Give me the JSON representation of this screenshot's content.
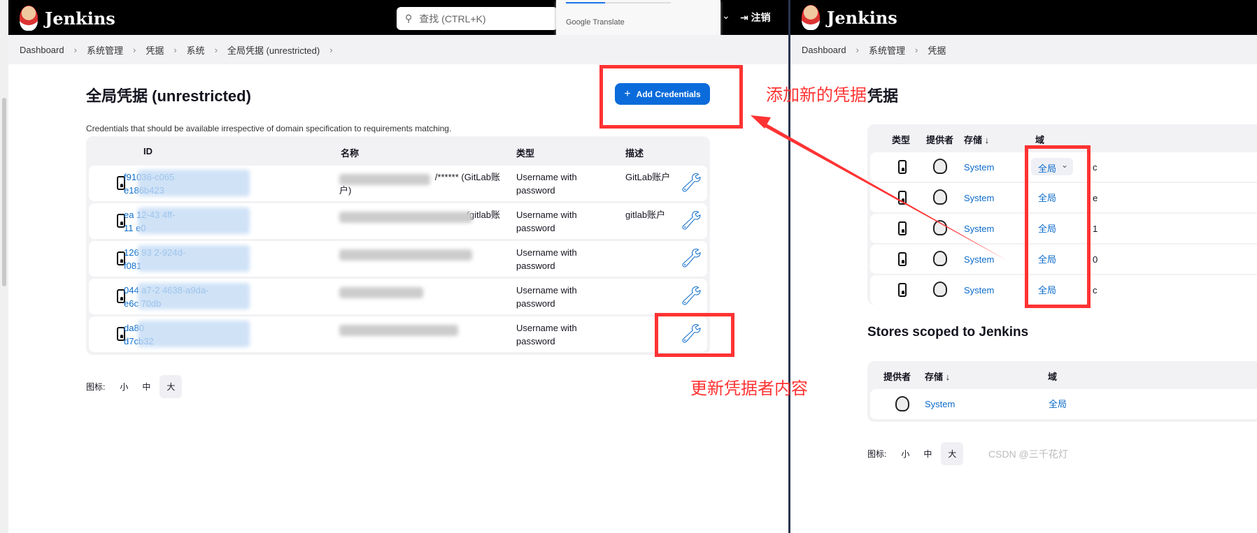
{
  "left": {
    "brand": "Jenkins",
    "search": {
      "placeholder": "查找 (CTRL+K)"
    },
    "translate_popup": "Google Translate",
    "logout": "注销",
    "breadcrumb": [
      "Dashboard",
      "系统管理",
      "凭据",
      "系统",
      "全局凭据 (unrestricted)"
    ],
    "title": "全局凭据 (unrestricted)",
    "add_button": "Add Credentials",
    "description": "Credentials that should be available irrespective of domain specification to requirements matching.",
    "columns": [
      "ID",
      "名称",
      "类型",
      "描述"
    ],
    "rows": [
      {
        "id1": "f91036-c065",
        "id2": "e186b423",
        "name1": "/****** (GitLab账",
        "name2": "户)",
        "type": "Username with password",
        "desc": "GitLab账户"
      },
      {
        "id1": "ea    12-43    4ff-",
        "id2": "11     e0",
        "name1": "(gitlab账",
        "name2": "",
        "type": "Username with password",
        "desc": "gitlab账户"
      },
      {
        "id1": "126    93   2-924d-",
        "id2": "f081",
        "name1": "",
        "name2": "",
        "type": "Username with password",
        "desc": ""
      },
      {
        "id1": "044   a7-2   4638-a9da-",
        "id2": "e6c    70db",
        "name1": "",
        "name2": "",
        "type": "Username with password",
        "desc": ""
      },
      {
        "id1": "da80",
        "id2": "d7cb32",
        "name1": "",
        "name2": "",
        "type": "Username with password",
        "desc": ""
      }
    ],
    "icon_size": {
      "label": "图标:",
      "options": [
        "小",
        "中",
        "大"
      ],
      "selected": "大"
    }
  },
  "right": {
    "brand": "Jenkins",
    "breadcrumb": [
      "Dashboard",
      "系统管理",
      "凭据"
    ],
    "title": "凭据",
    "columns": [
      "类型",
      "提供者",
      "存储 ↓",
      "域"
    ],
    "rows": [
      {
        "store": "System",
        "domain": "全局",
        "cut": "c"
      },
      {
        "store": "System",
        "domain": "全局",
        "cut": "e"
      },
      {
        "store": "System",
        "domain": "全局",
        "cut": "1"
      },
      {
        "store": "System",
        "domain": "全局",
        "cut": "0"
      },
      {
        "store": "System",
        "domain": "全局",
        "cut": "c"
      }
    ],
    "stores_title": "Stores scoped to Jenkins",
    "stores_columns": [
      "提供者",
      "存储 ↓",
      "域"
    ],
    "stores_row": {
      "store": "System",
      "domain": "全局"
    },
    "icon_size": {
      "label": "图标:",
      "options": [
        "小",
        "中",
        "大"
      ],
      "selected": "大"
    }
  },
  "annotations": {
    "add_note": "添加新的凭据",
    "update_note": "更新凭据者内容",
    "color": "#ff3333"
  },
  "watermark": "CSDN @三千花灯"
}
